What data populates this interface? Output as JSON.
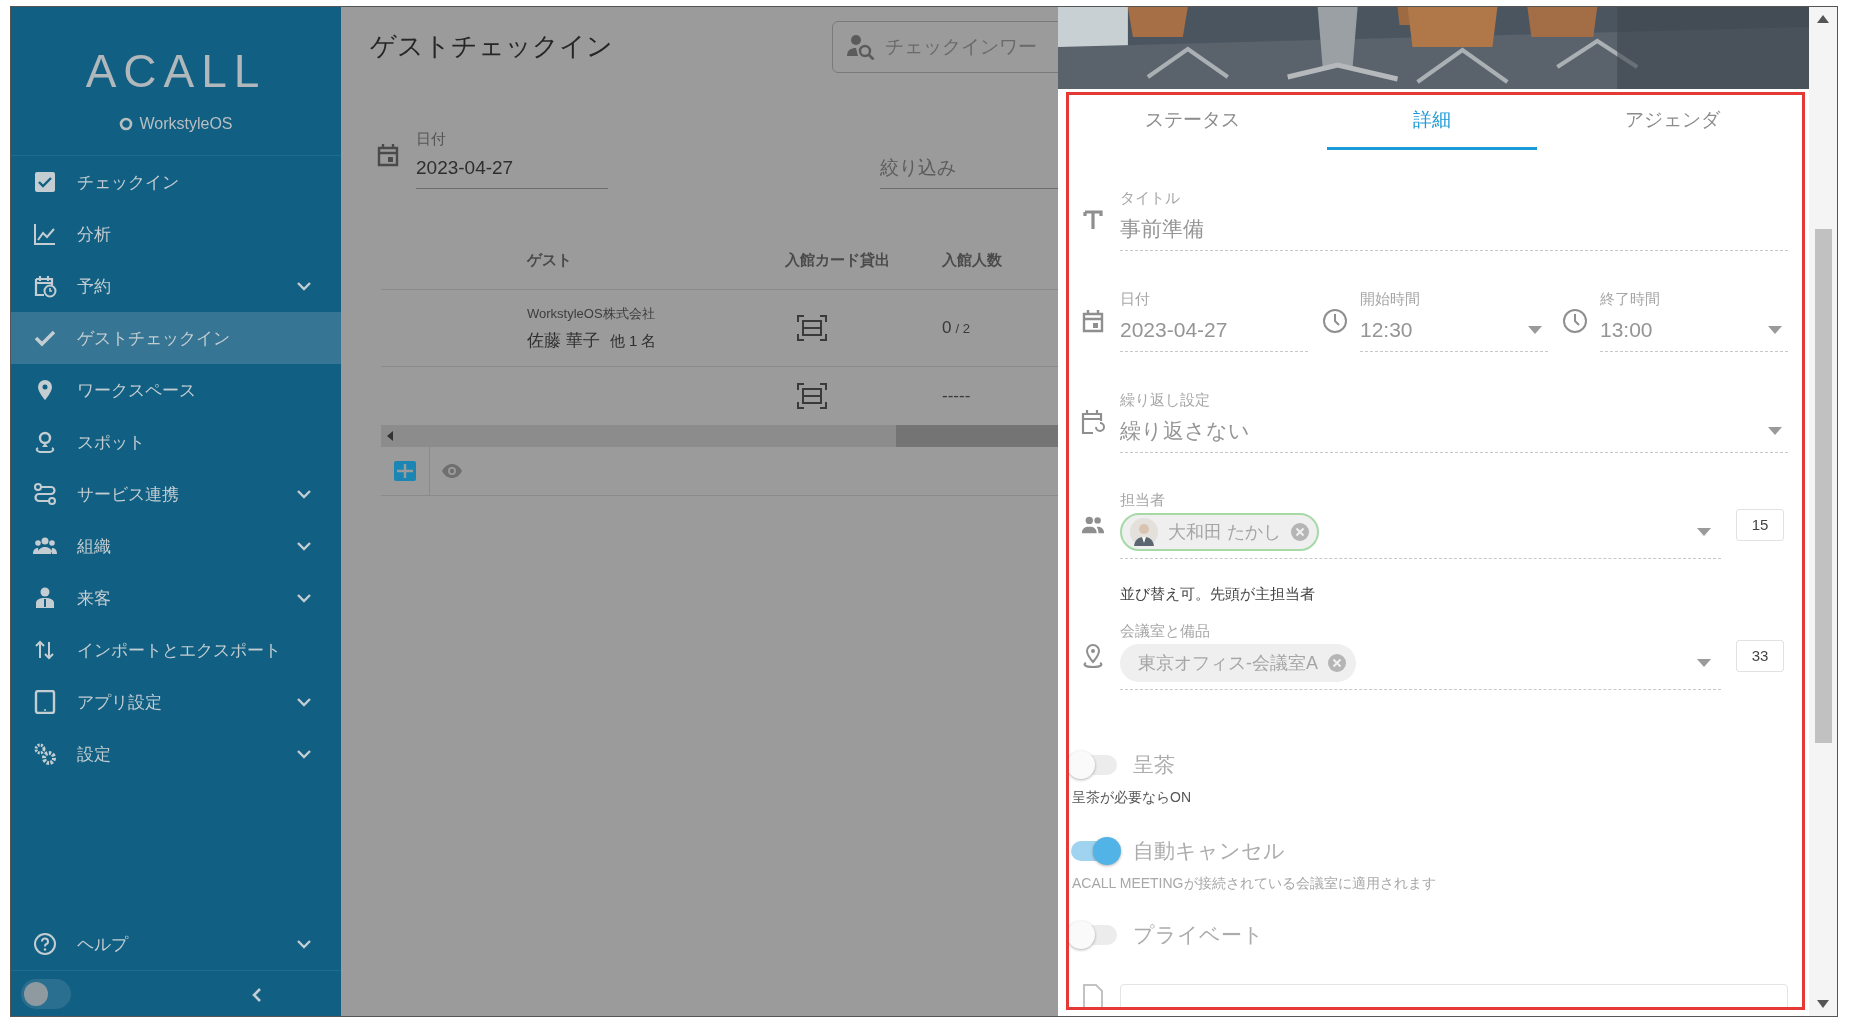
{
  "sidebar": {
    "logo": "ACALL",
    "product": "WorkstyleOS",
    "items": [
      {
        "label": "チェックイン",
        "selected": false,
        "expandable": false
      },
      {
        "label": "分析",
        "selected": false,
        "expandable": false
      },
      {
        "label": "予約",
        "selected": false,
        "expandable": true
      },
      {
        "label": "ゲストチェックイン",
        "selected": true,
        "expandable": false
      },
      {
        "label": "ワークスペース",
        "selected": false,
        "expandable": false
      },
      {
        "label": "スポット",
        "selected": false,
        "expandable": false
      },
      {
        "label": "サービス連携",
        "selected": false,
        "expandable": true
      },
      {
        "label": "組織",
        "selected": false,
        "expandable": true
      },
      {
        "label": "来客",
        "selected": false,
        "expandable": true
      },
      {
        "label": "インポートとエクスポート",
        "selected": false,
        "expandable": false
      },
      {
        "label": "アプリ設定",
        "selected": false,
        "expandable": true
      },
      {
        "label": "設定",
        "selected": false,
        "expandable": true
      }
    ],
    "help": {
      "label": "ヘルプ",
      "expandable": true
    },
    "theme_toggle": {
      "on": false
    }
  },
  "main": {
    "title": "ゲストチェックイン",
    "search": {
      "placeholder": "チェックインワー"
    },
    "date_field": {
      "label": "日付",
      "value": "2023-04-27"
    },
    "filter": {
      "placeholder": "絞り込み"
    },
    "table": {
      "columns": [
        "ゲスト",
        "入館カード貸出",
        "入館人数"
      ],
      "rows": [
        {
          "company": "WorkstyleOS株式会社",
          "name": "佐藤 華子",
          "others": "他 1 名",
          "count": "0",
          "capacity": "/ 2"
        },
        {
          "count": "-----"
        }
      ]
    },
    "views": [
      {
        "kind": "table",
        "selected": true
      },
      {
        "kind": "preview",
        "selected": false
      }
    ]
  },
  "panel": {
    "tabs": [
      {
        "label": "ステータス",
        "selected": false
      },
      {
        "label": "詳細",
        "selected": true
      },
      {
        "label": "アジェンダ",
        "selected": false
      }
    ],
    "title_field": {
      "label": "タイトル",
      "value": "事前準備"
    },
    "date_field": {
      "label": "日付",
      "value": "2023-04-27"
    },
    "start_time": {
      "label": "開始時間",
      "value": "12:30"
    },
    "end_time": {
      "label": "終了時間",
      "value": "13:00"
    },
    "repeat": {
      "label": "繰り返し設定",
      "value": "繰り返さない"
    },
    "hosts": {
      "label": "担当者",
      "chips": [
        {
          "label": "大和田 たかし",
          "kind": "person",
          "outlined": true
        }
      ],
      "count": "15",
      "hint": "並び替え可。先頭が主担当者"
    },
    "rooms": {
      "label": "会議室と備品",
      "chips": [
        {
          "label": "東京オフィス-会議室A",
          "kind": "place",
          "outlined": false
        }
      ],
      "count": "33"
    },
    "toggles": [
      {
        "label": "呈茶",
        "on": false,
        "hint": "呈茶が必要ならON"
      },
      {
        "label": "自動キャンセル",
        "on": true,
        "hint": "ACALL MEETINGが接続されている会議室に適用されます"
      },
      {
        "label": "プライベート",
        "on": false
      }
    ]
  }
}
